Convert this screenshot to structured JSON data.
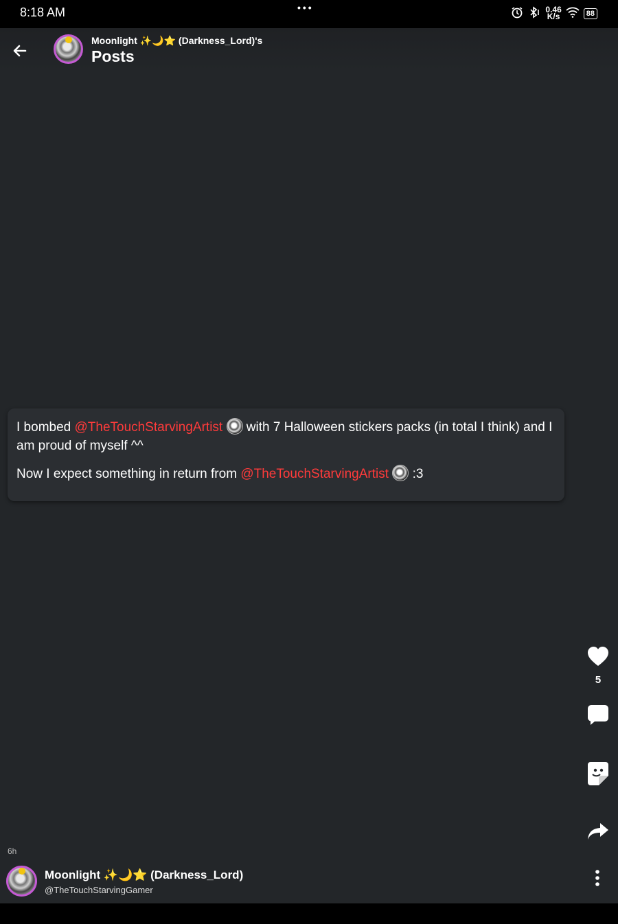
{
  "status": {
    "time": "8:18 AM",
    "dots": "•••",
    "net_speed_top": "0.46",
    "net_speed_bottom": "K/s",
    "battery": "88"
  },
  "header": {
    "subtitle": "Moonlight ✨🌙⭐ (Darkness_Lord)'s",
    "title": "Posts"
  },
  "post": {
    "p1_prefix": "I bombed ",
    "mention1": "@TheTouchStarvingArtist",
    "p1_suffix": " with 7 Halloween stickers packs (in total I think) and I am proud of myself ^^",
    "p2_prefix": "Now I expect something in return from ",
    "mention2": "@TheTouchStarvingArtist",
    "p2_suffix": " :3"
  },
  "actions": {
    "like_count": "5"
  },
  "footer": {
    "time_ago": "6h",
    "author_name": "Moonlight ✨🌙⭐ (Darkness_Lord)",
    "author_handle": "@TheTouchStarvingGamer"
  },
  "icons": {
    "back": "arrow-left",
    "like": "heart",
    "comment": "speech-bubble",
    "sticker": "sticker",
    "share": "share-arrow",
    "more": "vertical-dots"
  }
}
